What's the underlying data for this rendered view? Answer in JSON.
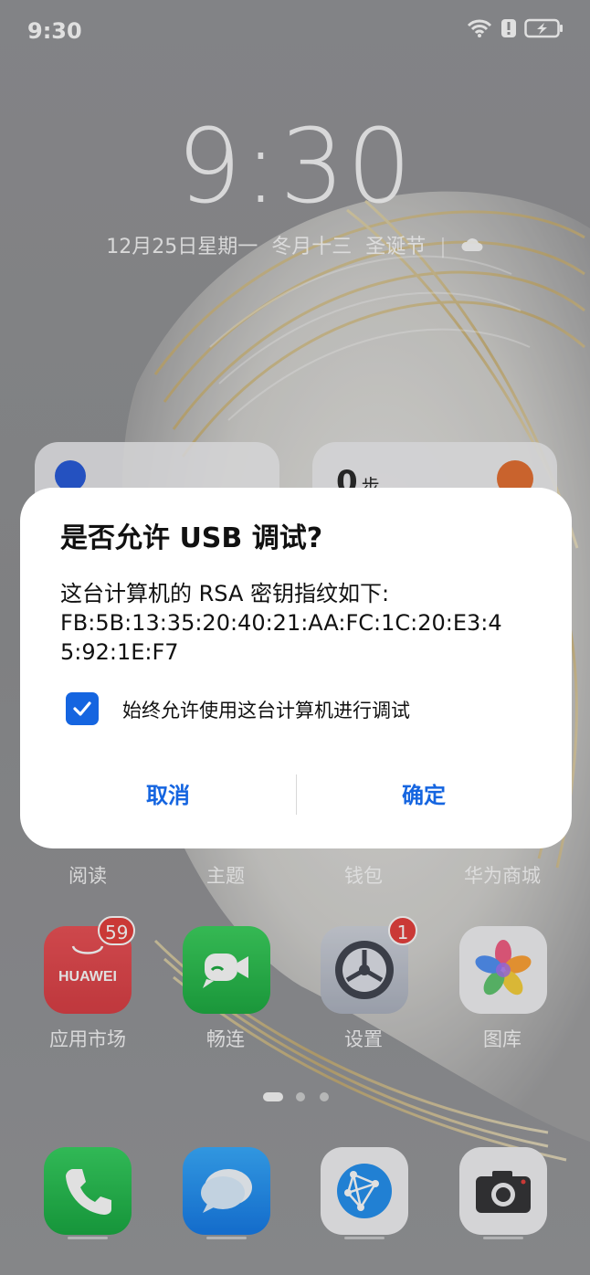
{
  "status_bar": {
    "time": "9:30"
  },
  "lockscreen": {
    "clock": "9:30",
    "date": "12月25日星期一",
    "lunar": "冬月十三",
    "holiday": "圣诞节",
    "separator": "|"
  },
  "widgets": {
    "steps_value": "0",
    "steps_unit": "步"
  },
  "dialog": {
    "title": "是否允许 USB 调试?",
    "body_line1": "这台计算机的 RSA 密钥指纹如下:",
    "body_line2": "FB:5B:13:35:20:40:21:AA:FC:1C:20:E3:4",
    "body_line3": "5:92:1E:F7",
    "checkbox_label": "始终允许使用这台计算机进行调试",
    "checkbox_checked": true,
    "cancel_label": "取消",
    "ok_label": "确定",
    "accent_color": "#1565e0"
  },
  "app_rows": {
    "row1_labels": [
      "阅读",
      "主题",
      "钱包",
      "华为商城"
    ],
    "row2": [
      {
        "label": "应用市场",
        "icon": "huawei-appgallery-icon",
        "icon_text": "HUAWEI",
        "badge": "59"
      },
      {
        "label": "畅连",
        "icon": "meetime-icon",
        "badge": ""
      },
      {
        "label": "设置",
        "icon": "settings-gear-icon",
        "badge": "1"
      },
      {
        "label": "图库",
        "icon": "gallery-icon",
        "badge": ""
      }
    ]
  },
  "dock": [
    {
      "icon": "phone-icon"
    },
    {
      "icon": "messages-icon"
    },
    {
      "icon": "browser-icon"
    },
    {
      "icon": "camera-icon"
    }
  ]
}
